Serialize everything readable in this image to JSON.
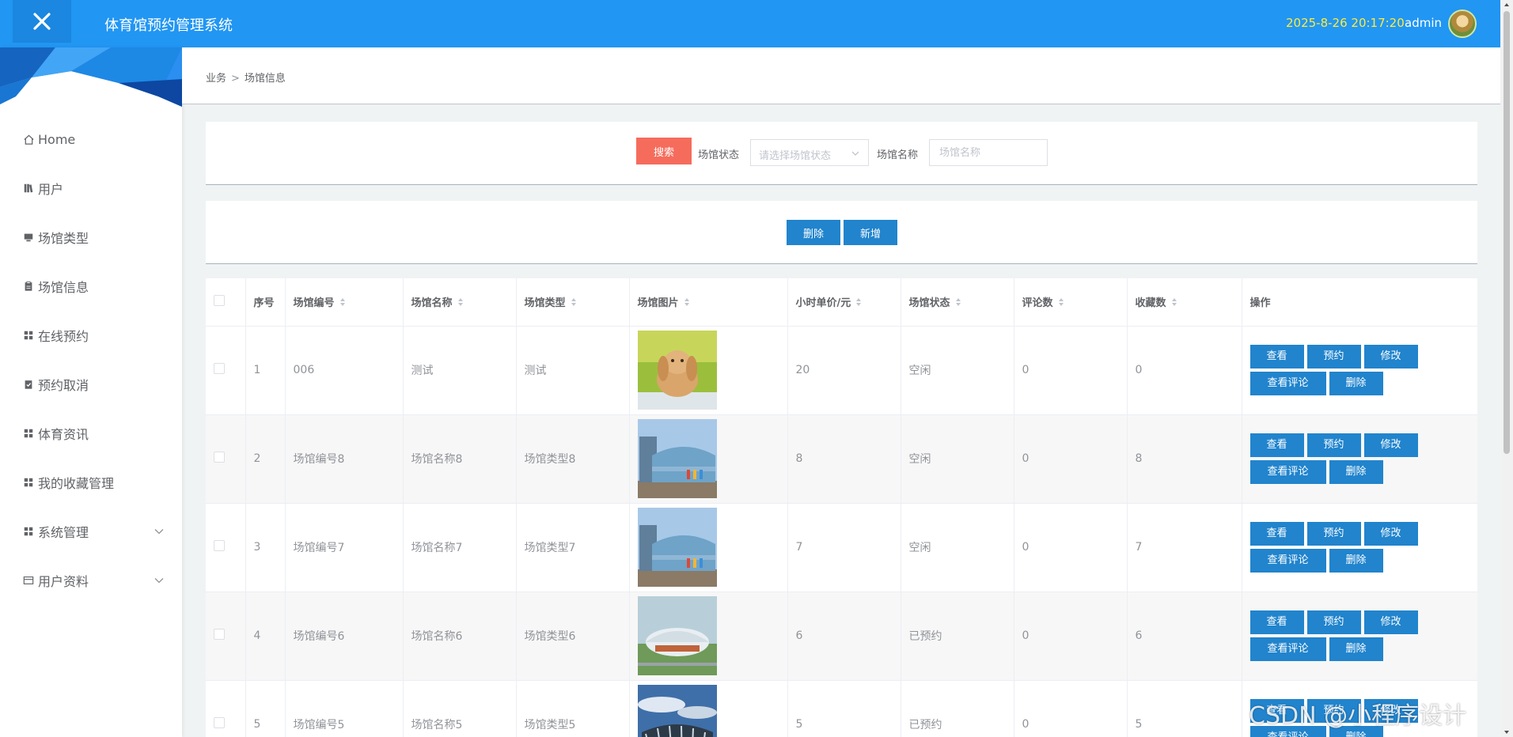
{
  "header": {
    "title": "体育馆预约管理系统",
    "datetime": "2025-8-26 20:17:20",
    "username": "admin",
    "bg_color": "#2196f3"
  },
  "sidebar": {
    "items": [
      {
        "label": "Home",
        "icon": "home-icon"
      },
      {
        "label": "用户",
        "icon": "book-icon"
      },
      {
        "label": "场馆类型",
        "icon": "monitor-icon"
      },
      {
        "label": "场馆信息",
        "icon": "clipboard-icon"
      },
      {
        "label": "在线预约",
        "icon": "grid-icon"
      },
      {
        "label": "预约取消",
        "icon": "check-clipboard-icon"
      },
      {
        "label": "体育资讯",
        "icon": "grid-icon"
      },
      {
        "label": "我的收藏管理",
        "icon": "grid-icon"
      },
      {
        "label": "系统管理",
        "icon": "grid-icon",
        "expandable": true
      },
      {
        "label": "用户资料",
        "icon": "card-icon",
        "expandable": true
      }
    ]
  },
  "breadcrumb": {
    "parent": "业务",
    "separator": ">",
    "current": "场馆信息"
  },
  "search": {
    "button": "搜索",
    "status_label": "场馆状态",
    "status_placeholder": "请选择场馆状态",
    "name_label": "场馆名称",
    "name_placeholder": "场馆名称"
  },
  "actions": {
    "delete": "删除",
    "add": "新增"
  },
  "table": {
    "headers": [
      "序号",
      "场馆编号",
      "场馆名称",
      "场馆类型",
      "场馆图片",
      "小时单价/元",
      "场馆状态",
      "评论数",
      "收藏数",
      "操作"
    ],
    "rows": [
      {
        "index": "1",
        "code": "006",
        "name": "测试",
        "type": "测试",
        "image": "rabbit",
        "price": "20",
        "status": "空闲",
        "comments": "0",
        "favorites": "0"
      },
      {
        "index": "2",
        "code": "场馆编号8",
        "name": "场馆名称8",
        "type": "场馆类型8",
        "image": "arena",
        "price": "8",
        "status": "空闲",
        "comments": "0",
        "favorites": "8"
      },
      {
        "index": "3",
        "code": "场馆编号7",
        "name": "场馆名称7",
        "type": "场馆类型7",
        "image": "arena",
        "price": "7",
        "status": "空闲",
        "comments": "0",
        "favorites": "7"
      },
      {
        "index": "4",
        "code": "场馆编号6",
        "name": "场馆名称6",
        "type": "场馆类型6",
        "image": "stadium-aerial",
        "price": "6",
        "status": "已预约",
        "comments": "0",
        "favorites": "6"
      },
      {
        "index": "5",
        "code": "场馆编号5",
        "name": "场馆名称5",
        "type": "场馆类型5",
        "image": "stadium-sky",
        "price": "5",
        "status": "已预约",
        "comments": "0",
        "favorites": "5"
      }
    ],
    "ops": {
      "view": "查看",
      "book": "预约",
      "edit": "修改",
      "comments": "查看评论",
      "delete": "删除"
    }
  },
  "watermark": "CSDN @小程序设计",
  "colors": {
    "primary": "#2184cd",
    "danger": "#f56c5c",
    "datetime": "#ffeb3b"
  }
}
